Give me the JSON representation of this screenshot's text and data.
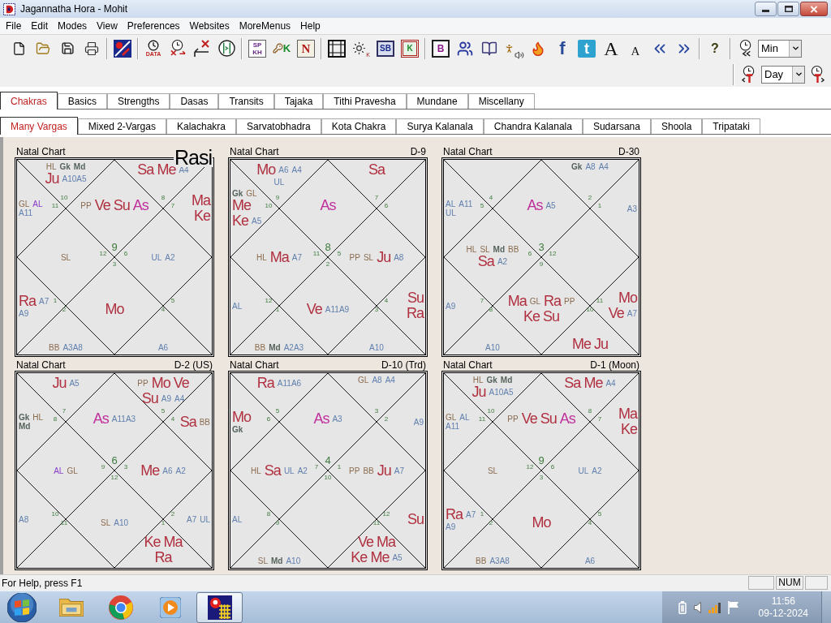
{
  "window": {
    "title": "Jagannatha Hora - Mohit"
  },
  "menu": [
    "File",
    "Edit",
    "Modes",
    "View",
    "Preferences",
    "Websites",
    "MoreMenus",
    "Help"
  ],
  "toolbar_labels": [
    "DATA",
    "SP KH",
    "K",
    "N",
    "K",
    "SB",
    "K",
    "B",
    "f",
    "t",
    "A",
    "A",
    "?"
  ],
  "toolbar_periods": [
    "Min",
    "Day"
  ],
  "tabs": [
    {
      "label": "Chakras",
      "selected": true
    },
    {
      "label": "Basics",
      "selected": false
    },
    {
      "label": "Strengths",
      "selected": false
    },
    {
      "label": "Dasas",
      "selected": false
    },
    {
      "label": "Transits",
      "selected": false
    },
    {
      "label": "Tajaka",
      "selected": false
    },
    {
      "label": "Tithi Pravesha",
      "selected": false
    },
    {
      "label": "Mundane",
      "selected": false
    },
    {
      "label": "Miscellany",
      "selected": false
    }
  ],
  "subtabs": [
    {
      "label": "Many Vargas",
      "selected": true
    },
    {
      "label": "Mixed 2-Vargas",
      "selected": false
    },
    {
      "label": "Kalachakra",
      "selected": false
    },
    {
      "label": "Sarvatobhadra",
      "selected": false
    },
    {
      "label": "Kota Chakra",
      "selected": false
    },
    {
      "label": "Surya Kalanala",
      "selected": false
    },
    {
      "label": "Chandra Kalanala",
      "selected": false
    },
    {
      "label": "Sudarsana",
      "selected": false
    },
    {
      "label": "Shoola",
      "selected": false
    },
    {
      "label": "Tripataki",
      "selected": false
    }
  ],
  "charts": [
    {
      "title": "Natal Chart",
      "label": "Rasi",
      "label_large": true,
      "houses": [
        {
          "sign": "10",
          "items": [
            {
              "text": "HL",
              "kind": "point"
            },
            {
              "text": "Gk",
              "kind": "upagraha"
            },
            {
              "text": "Md",
              "kind": "upagraha"
            },
            {
              "text": "Ju",
              "kind": "graha"
            },
            {
              "text": "A10A5",
              "kind": "arudha"
            }
          ]
        },
        {
          "sign": "8",
          "items": [
            {
              "text": "Sa",
              "kind": "graha"
            },
            {
              "text": "Me",
              "kind": "graha"
            },
            {
              "text": "A4",
              "kind": "arudha"
            }
          ]
        },
        {
          "sign": "11",
          "items": [
            {
              "text": "GL",
              "kind": "point"
            },
            {
              "text": "AL",
              "kind": "arudha_lagna"
            },
            {
              "text": "A11",
              "kind": "arudha"
            }
          ]
        },
        {
          "sign": "9",
          "items": [
            {
              "text": "PP",
              "kind": "point"
            },
            {
              "text": "Ve",
              "kind": "graha"
            },
            {
              "text": "Su",
              "kind": "graha"
            },
            {
              "text": "As",
              "kind": "lagna"
            }
          ]
        },
        {
          "sign": "7",
          "items": [
            {
              "text": "Ma",
              "kind": "graha"
            },
            {
              "text": "Ke",
              "kind": "graha"
            }
          ]
        },
        {
          "sign": "12",
          "items": [
            {
              "text": "SL",
              "kind": "point"
            }
          ]
        },
        {
          "sign": "6",
          "items": [
            {
              "text": "UL",
              "kind": "arudha"
            },
            {
              "text": "A2",
              "kind": "arudha"
            }
          ]
        },
        {
          "sign": "1",
          "items": [
            {
              "text": "Ra",
              "kind": "graha"
            },
            {
              "text": "A7",
              "kind": "arudha"
            },
            {
              "text": "A9",
              "kind": "arudha"
            }
          ]
        },
        {
          "sign": "3",
          "items": [
            {
              "text": "Mo",
              "kind": "graha"
            }
          ]
        },
        {
          "sign": "5"
        },
        {
          "sign": "2",
          "items": [
            {
              "text": "BB",
              "kind": "point"
            },
            {
              "text": "A3A8",
              "kind": "arudha"
            }
          ]
        },
        {
          "sign": "4",
          "items": [
            {
              "text": "A6",
              "kind": "arudha"
            }
          ]
        }
      ]
    },
    {
      "title": "Natal Chart",
      "label": "D-9",
      "label_large": false,
      "houses": [
        {
          "sign": "9",
          "items": [
            {
              "text": "Mo",
              "kind": "graha"
            },
            {
              "text": "A6",
              "kind": "arudha"
            },
            {
              "text": "A4",
              "kind": "arudha"
            },
            {
              "text": "UL",
              "kind": "arudha"
            }
          ]
        },
        {
          "sign": "7",
          "items": [
            {
              "text": "Sa",
              "kind": "graha"
            }
          ]
        },
        {
          "sign": "10",
          "items": [
            {
              "text": "Gk",
              "kind": "upagraha"
            },
            {
              "text": "GL",
              "kind": "point"
            },
            {
              "text": "Me",
              "kind": "graha"
            },
            {
              "text": "Ke",
              "kind": "graha"
            },
            {
              "text": "A5",
              "kind": "arudha"
            }
          ]
        },
        {
          "sign": "8",
          "items": [
            {
              "text": "As",
              "kind": "lagna"
            }
          ]
        },
        {
          "sign": "6"
        },
        {
          "sign": "11",
          "items": [
            {
              "text": "HL",
              "kind": "point"
            },
            {
              "text": "Ma",
              "kind": "graha"
            },
            {
              "text": "A7",
              "kind": "arudha"
            }
          ]
        },
        {
          "sign": "5",
          "items": [
            {
              "text": "PP",
              "kind": "point"
            },
            {
              "text": "SL",
              "kind": "point"
            },
            {
              "text": "Ju",
              "kind": "graha"
            },
            {
              "text": "A8",
              "kind": "arudha"
            }
          ]
        },
        {
          "sign": "12",
          "items": [
            {
              "text": "AL",
              "kind": "arudha"
            }
          ]
        },
        {
          "sign": "2",
          "items": [
            {
              "text": "Ve",
              "kind": "graha"
            },
            {
              "text": "A11A9",
              "kind": "arudha"
            }
          ]
        },
        {
          "sign": "4",
          "items": [
            {
              "text": "Su",
              "kind": "graha"
            },
            {
              "text": "Ra",
              "kind": "graha"
            }
          ]
        },
        {
          "sign": "1",
          "items": [
            {
              "text": "BB",
              "kind": "point"
            },
            {
              "text": "Md",
              "kind": "upagraha"
            },
            {
              "text": "A2A3",
              "kind": "arudha"
            }
          ]
        },
        {
          "sign": "3",
          "items": [
            {
              "text": "A10",
              "kind": "arudha"
            }
          ]
        }
      ]
    },
    {
      "title": "Natal Chart",
      "label": "D-30",
      "label_large": false,
      "houses": [
        {
          "sign": "4"
        },
        {
          "sign": "2",
          "items": [
            {
              "text": "Gk",
              "kind": "upagraha"
            },
            {
              "text": "A8",
              "kind": "arudha"
            },
            {
              "text": "A4",
              "kind": "arudha"
            }
          ]
        },
        {
          "sign": "5",
          "items": [
            {
              "text": "AL",
              "kind": "arudha"
            },
            {
              "text": "A11",
              "kind": "arudha"
            },
            {
              "text": "UL",
              "kind": "arudha"
            }
          ]
        },
        {
          "sign": "3",
          "items": [
            {
              "text": "As",
              "kind": "lagna"
            },
            {
              "text": "A5",
              "kind": "arudha"
            }
          ]
        },
        {
          "sign": "1",
          "items": [
            {
              "text": "A3",
              "kind": "arudha"
            }
          ]
        },
        {
          "sign": "6",
          "items": [
            {
              "text": "HL",
              "kind": "point"
            },
            {
              "text": "SL",
              "kind": "point"
            },
            {
              "text": "Md",
              "kind": "upagraha"
            },
            {
              "text": "BB",
              "kind": "point"
            },
            {
              "text": "Sa",
              "kind": "graha"
            },
            {
              "text": "A2",
              "kind": "arudha"
            }
          ]
        },
        {
          "sign": "12"
        },
        {
          "sign": "7",
          "items": [
            {
              "text": "A9",
              "kind": "arudha"
            }
          ]
        },
        {
          "sign": "9",
          "items": [
            {
              "text": "Ma",
              "kind": "graha"
            },
            {
              "text": "GL",
              "kind": "point"
            },
            {
              "text": "Ra",
              "kind": "graha"
            },
            {
              "text": "PP",
              "kind": "point"
            },
            {
              "text": "Ke",
              "kind": "graha"
            },
            {
              "text": "Su",
              "kind": "graha"
            }
          ]
        },
        {
          "sign": "11",
          "items": [
            {
              "text": "Mo",
              "kind": "graha"
            },
            {
              "text": "Ve",
              "kind": "graha"
            },
            {
              "text": "A7",
              "kind": "arudha"
            }
          ]
        },
        {
          "sign": "8",
          "items": [
            {
              "text": "A10",
              "kind": "arudha"
            }
          ]
        },
        {
          "sign": "10",
          "items": [
            {
              "text": "Me",
              "kind": "graha"
            },
            {
              "text": "Ju",
              "kind": "graha"
            }
          ]
        }
      ]
    },
    {
      "title": "Natal Chart",
      "label": "D-2 (US)",
      "label_large": false,
      "houses": [
        {
          "sign": "7",
          "items": [
            {
              "text": "Ju",
              "kind": "graha"
            },
            {
              "text": "A5",
              "kind": "arudha"
            }
          ]
        },
        {
          "sign": "5",
          "items": [
            {
              "text": "PP",
              "kind": "point"
            },
            {
              "text": "Mo",
              "kind": "graha"
            },
            {
              "text": "Ve",
              "kind": "graha"
            },
            {
              "text": "Su",
              "kind": "graha"
            },
            {
              "text": "A9",
              "kind": "arudha"
            },
            {
              "text": "A4",
              "kind": "arudha"
            }
          ]
        },
        {
          "sign": "8",
          "items": [
            {
              "text": "Gk",
              "kind": "upagraha"
            },
            {
              "text": "HL",
              "kind": "point"
            },
            {
              "text": "Md",
              "kind": "upagraha"
            }
          ]
        },
        {
          "sign": "6",
          "items": [
            {
              "text": "As",
              "kind": "lagna"
            },
            {
              "text": "A11A3",
              "kind": "arudha"
            }
          ]
        },
        {
          "sign": "4",
          "items": [
            {
              "text": "Sa",
              "kind": "graha"
            },
            {
              "text": "BB",
              "kind": "point"
            }
          ]
        },
        {
          "sign": "9",
          "items": [
            {
              "text": "AL",
              "kind": "arudha_lagna"
            },
            {
              "text": "GL",
              "kind": "point"
            }
          ]
        },
        {
          "sign": "3",
          "items": [
            {
              "text": "Me",
              "kind": "graha"
            },
            {
              "text": "A6",
              "kind": "arudha"
            },
            {
              "text": "A2",
              "kind": "arudha"
            }
          ]
        },
        {
          "sign": "10",
          "items": [
            {
              "text": "A8",
              "kind": "arudha"
            }
          ]
        },
        {
          "sign": "12",
          "items": [
            {
              "text": "SL",
              "kind": "point"
            },
            {
              "text": "A10",
              "kind": "arudha"
            }
          ]
        },
        {
          "sign": "2",
          "items": [
            {
              "text": "A7",
              "kind": "arudha"
            },
            {
              "text": "UL",
              "kind": "arudha"
            }
          ]
        },
        {
          "sign": "11"
        },
        {
          "sign": "1",
          "items": [
            {
              "text": "Ke",
              "kind": "graha"
            },
            {
              "text": "Ma",
              "kind": "graha"
            },
            {
              "text": "Ra",
              "kind": "graha"
            }
          ]
        }
      ]
    },
    {
      "title": "Natal Chart",
      "label": "D-10 (Trd)",
      "label_large": false,
      "houses": [
        {
          "sign": "5",
          "items": [
            {
              "text": "Ra",
              "kind": "graha"
            },
            {
              "text": "A11A6",
              "kind": "arudha"
            }
          ]
        },
        {
          "sign": "3",
          "items": [
            {
              "text": "GL",
              "kind": "point"
            },
            {
              "text": "A8",
              "kind": "arudha"
            },
            {
              "text": "A4",
              "kind": "arudha"
            }
          ]
        },
        {
          "sign": "6",
          "items": [
            {
              "text": "Mo",
              "kind": "graha"
            },
            {
              "text": "Gk",
              "kind": "upagraha"
            }
          ]
        },
        {
          "sign": "4",
          "items": [
            {
              "text": "As",
              "kind": "lagna"
            },
            {
              "text": "A3",
              "kind": "arudha"
            }
          ]
        },
        {
          "sign": "2",
          "items": [
            {
              "text": "A9",
              "kind": "arudha"
            }
          ]
        },
        {
          "sign": "7",
          "items": [
            {
              "text": "HL",
              "kind": "point"
            },
            {
              "text": "Sa",
              "kind": "graha"
            },
            {
              "text": "UL",
              "kind": "arudha"
            },
            {
              "text": "A2",
              "kind": "arudha"
            }
          ]
        },
        {
          "sign": "1",
          "items": [
            {
              "text": "PP",
              "kind": "point"
            },
            {
              "text": "BB",
              "kind": "point"
            },
            {
              "text": "Ju",
              "kind": "graha"
            },
            {
              "text": "A7",
              "kind": "arudha"
            }
          ]
        },
        {
          "sign": "8",
          "items": [
            {
              "text": "AL",
              "kind": "arudha"
            }
          ]
        },
        {
          "sign": "10"
        },
        {
          "sign": "12",
          "items": [
            {
              "text": "Su",
              "kind": "graha"
            }
          ]
        },
        {
          "sign": "9",
          "items": [
            {
              "text": "SL",
              "kind": "point"
            },
            {
              "text": "Md",
              "kind": "upagraha"
            },
            {
              "text": "A10",
              "kind": "arudha"
            }
          ]
        },
        {
          "sign": "11",
          "items": [
            {
              "text": "Ve",
              "kind": "graha"
            },
            {
              "text": "Ma",
              "kind": "graha"
            },
            {
              "text": "Ke",
              "kind": "graha"
            },
            {
              "text": "Me",
              "kind": "graha"
            },
            {
              "text": "A5",
              "kind": "arudha"
            }
          ]
        }
      ]
    },
    {
      "title": "Natal Chart",
      "label": "D-1 (Moon)",
      "label_large": false,
      "houses": [
        {
          "sign": "10",
          "items": [
            {
              "text": "HL",
              "kind": "point"
            },
            {
              "text": "Gk",
              "kind": "upagraha"
            },
            {
              "text": "Md",
              "kind": "upagraha"
            },
            {
              "text": "Ju",
              "kind": "graha"
            },
            {
              "text": "A10A5",
              "kind": "arudha"
            }
          ]
        },
        {
          "sign": "8",
          "items": [
            {
              "text": "Sa",
              "kind": "graha"
            },
            {
              "text": "Me",
              "kind": "graha"
            },
            {
              "text": "A4",
              "kind": "arudha"
            }
          ]
        },
        {
          "sign": "11",
          "items": [
            {
              "text": "GL",
              "kind": "point"
            },
            {
              "text": "AL",
              "kind": "arudha"
            },
            {
              "text": "A11",
              "kind": "arudha"
            }
          ]
        },
        {
          "sign": "9",
          "items": [
            {
              "text": "PP",
              "kind": "point"
            },
            {
              "text": "Ve",
              "kind": "graha"
            },
            {
              "text": "Su",
              "kind": "graha"
            },
            {
              "text": "As",
              "kind": "lagna"
            }
          ]
        },
        {
          "sign": "7",
          "items": [
            {
              "text": "Ma",
              "kind": "graha"
            },
            {
              "text": "Ke",
              "kind": "graha"
            }
          ]
        },
        {
          "sign": "12",
          "items": [
            {
              "text": "SL",
              "kind": "point"
            }
          ]
        },
        {
          "sign": "6",
          "items": [
            {
              "text": "UL",
              "kind": "arudha"
            },
            {
              "text": "A2",
              "kind": "arudha"
            }
          ]
        },
        {
          "sign": "1",
          "items": [
            {
              "text": "Ra",
              "kind": "graha"
            },
            {
              "text": "A7",
              "kind": "arudha"
            },
            {
              "text": "A9",
              "kind": "arudha"
            }
          ]
        },
        {
          "sign": "3",
          "items": [
            {
              "text": "Mo",
              "kind": "graha"
            }
          ]
        },
        {
          "sign": "5"
        },
        {
          "sign": "2",
          "items": [
            {
              "text": "BB",
              "kind": "point"
            },
            {
              "text": "A3A8",
              "kind": "arudha"
            }
          ]
        },
        {
          "sign": "4",
          "items": [
            {
              "text": "A6",
              "kind": "arudha"
            }
          ]
        }
      ]
    }
  ],
  "status_bar": {
    "text": "For Help, press F1",
    "indicator": "NUM"
  },
  "taskbar": {
    "apps": [
      {
        "selected": false
      },
      {
        "selected": false
      },
      {
        "selected": false
      },
      {
        "selected": true
      }
    ],
    "time": "11:56",
    "date": "09-12-2024"
  }
}
